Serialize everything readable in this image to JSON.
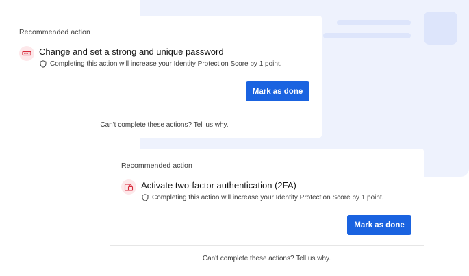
{
  "background": {
    "panel_color": "#eef2fd",
    "accent_color": "#dde5fb"
  },
  "cards": [
    {
      "eyebrow": "Recommended action",
      "icon": "password-icon",
      "title": "Change and set a strong and unique password",
      "note": "Completing this action will increase your Identity Protection Score by 1 point.",
      "note_icon": "shield-icon",
      "button_label": "Mark as done",
      "footer_link": "Can't complete these actions? Tell us why."
    },
    {
      "eyebrow": "Recommended action",
      "icon": "lock-devices-icon",
      "title": "Activate two-factor authentication (2FA)",
      "note": "Completing this action will increase your Identity Protection Score by 1 point.",
      "note_icon": "shield-icon",
      "button_label": "Mark as done",
      "footer_link": "Can't complete these actions? Tell us why."
    }
  ],
  "colors": {
    "primary_button": "#1a63e0",
    "icon_badge_bg": "#fde8ea",
    "icon_accent": "#d62839"
  }
}
